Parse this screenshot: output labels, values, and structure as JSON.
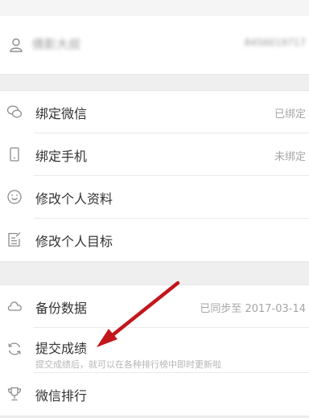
{
  "user": {
    "name": "倩影大叔",
    "id": "8456019717"
  },
  "account_group": [
    {
      "icon": "wechat-icon",
      "label": "绑定微信",
      "value": "已绑定"
    },
    {
      "icon": "phone-icon",
      "label": "绑定手机",
      "value": "未绑定"
    },
    {
      "icon": "smile-icon",
      "label": "修改个人资料",
      "value": ""
    },
    {
      "icon": "edit-icon",
      "label": "修改个人目标",
      "value": ""
    }
  ],
  "data_group": {
    "backup": {
      "icon": "cloud-icon",
      "label": "备份数据",
      "value": "已同步至 2017-03-14"
    },
    "submit": {
      "icon": "refresh-icon",
      "label": "提交成绩",
      "sub": "提交成绩后，就可以在各种排行榜中即时更新啦"
    },
    "ranking": {
      "icon": "trophy-icon",
      "label": "微信排行"
    }
  },
  "colors": {
    "annotation_arrow": "#c3161c",
    "text": "#333333",
    "muted": "#a6a6a6"
  }
}
